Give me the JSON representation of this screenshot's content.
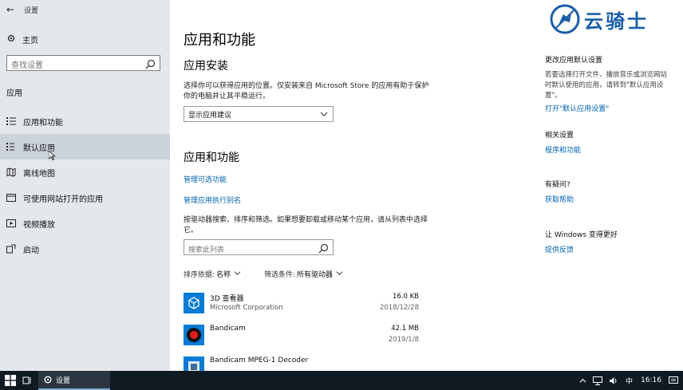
{
  "sidebar": {
    "window_title": "设置",
    "home": "主页",
    "search_placeholder": "查找设置",
    "section": "应用",
    "items": [
      {
        "label": "应用和功能",
        "icon": "list-icon"
      },
      {
        "label": "默认应用",
        "icon": "default-apps-icon",
        "active": true
      },
      {
        "label": "离线地图",
        "icon": "map-icon"
      },
      {
        "label": "可使用网站打开的应用",
        "icon": "website-icon"
      },
      {
        "label": "视频播放",
        "icon": "video-icon"
      },
      {
        "label": "启动",
        "icon": "startup-icon"
      }
    ]
  },
  "main": {
    "title": "应用和功能",
    "install": {
      "heading": "应用安装",
      "desc": "选择你可以获得应用的位置。仅安装来自 Microsoft Store 的应用有助于保护你的电脑并让其平稳运行。",
      "dropdown_value": "显示应用建议"
    },
    "apps": {
      "heading": "应用和功能",
      "link_optional": "管理可选功能",
      "link_alias": "管理应用执行别名",
      "desc": "按驱动器搜索、排序和筛选。如果想要卸载或移动某个应用，请从列表中选择它。",
      "search_placeholder": "搜索此列表",
      "sort_label": "排序依据:",
      "sort_value": "名称",
      "filter_label": "筛选条件:",
      "filter_value": "所有驱动器",
      "list": [
        {
          "name": "3D 查看器",
          "publisher": "Microsoft Corporation",
          "size": "16.0 KB",
          "date": "2018/12/28"
        },
        {
          "name": "Bandicam",
          "publisher": "",
          "size": "42.1 MB",
          "date": "2019/1/8"
        },
        {
          "name": "Bandicam MPEG-1 Decoder",
          "publisher": "",
          "size": "",
          "date": ""
        }
      ]
    }
  },
  "right_panel": {
    "default_heading": "更改应用默认设置",
    "default_text": "若要选择打开文件、播放音乐或浏览网站时默认使用的应用，请转到\"默认应用设置\"。",
    "default_link": "打开\"默认应用设置\"",
    "related_heading": "相关设置",
    "related_link": "程序和功能",
    "question_heading": "有疑问?",
    "question_link": "获取帮助",
    "better_heading": "让 Windows 变得更好",
    "better_link": "提供反馈"
  },
  "logo": {
    "text": "云骑士"
  },
  "taskbar": {
    "app_label": "设置",
    "ime": "中",
    "clock": "16:16"
  },
  "colors": {
    "accent": "#0063b1",
    "sidebar_bg": "#e4e7ec",
    "taskbar_bg": "#0f1a22"
  }
}
